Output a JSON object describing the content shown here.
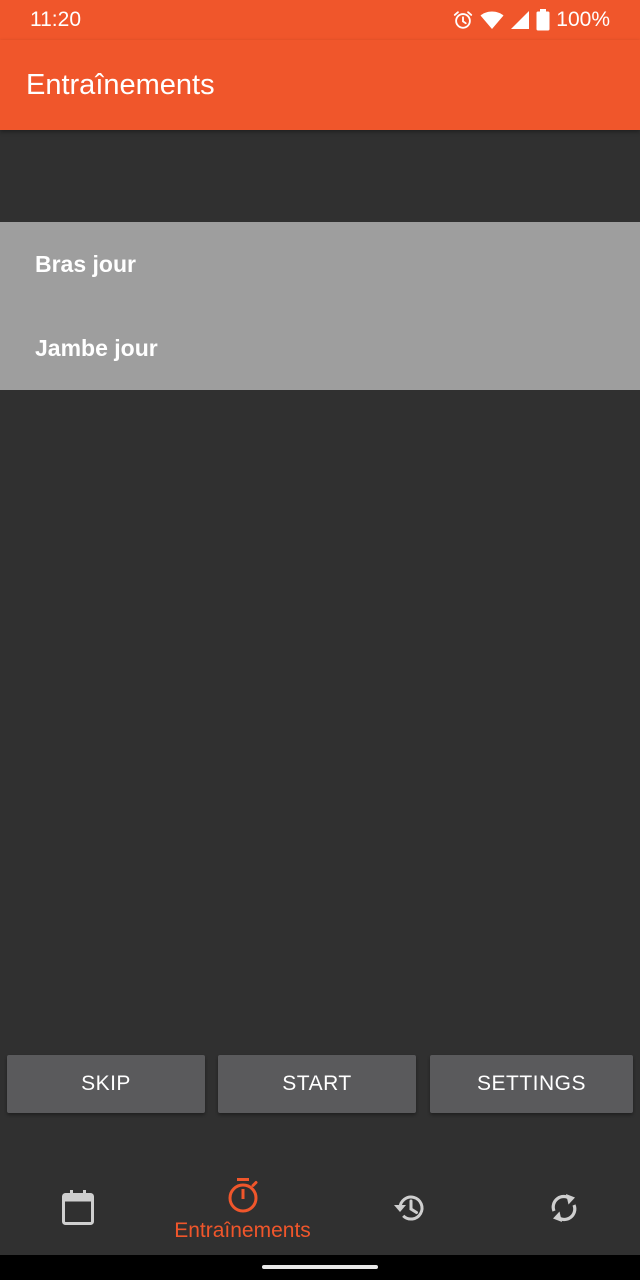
{
  "status_bar": {
    "time": "11:20",
    "battery_text": "100%",
    "icons": [
      "alarm-icon",
      "wifi-icon",
      "signal-icon",
      "battery-icon"
    ]
  },
  "app_bar": {
    "title": "Entraînements"
  },
  "workouts": {
    "items": [
      {
        "label": "Bras jour"
      },
      {
        "label": "Jambe jour"
      }
    ]
  },
  "actions": {
    "skip_label": "SKIP",
    "start_label": "START",
    "settings_label": "SETTINGS"
  },
  "bottom_nav": {
    "items": [
      {
        "icon": "calendar-icon",
        "label": "",
        "selected": false
      },
      {
        "icon": "timer-icon",
        "label": "Entraînements",
        "selected": true
      },
      {
        "icon": "history-icon",
        "label": "",
        "selected": false
      },
      {
        "icon": "sync-icon",
        "label": "",
        "selected": false
      }
    ]
  },
  "colors": {
    "accent": "#f0562b",
    "background": "#303030",
    "list_background": "#9e9e9e",
    "button": "#5a5a5c",
    "nav_icon_inactive": "#cfcfcf"
  }
}
